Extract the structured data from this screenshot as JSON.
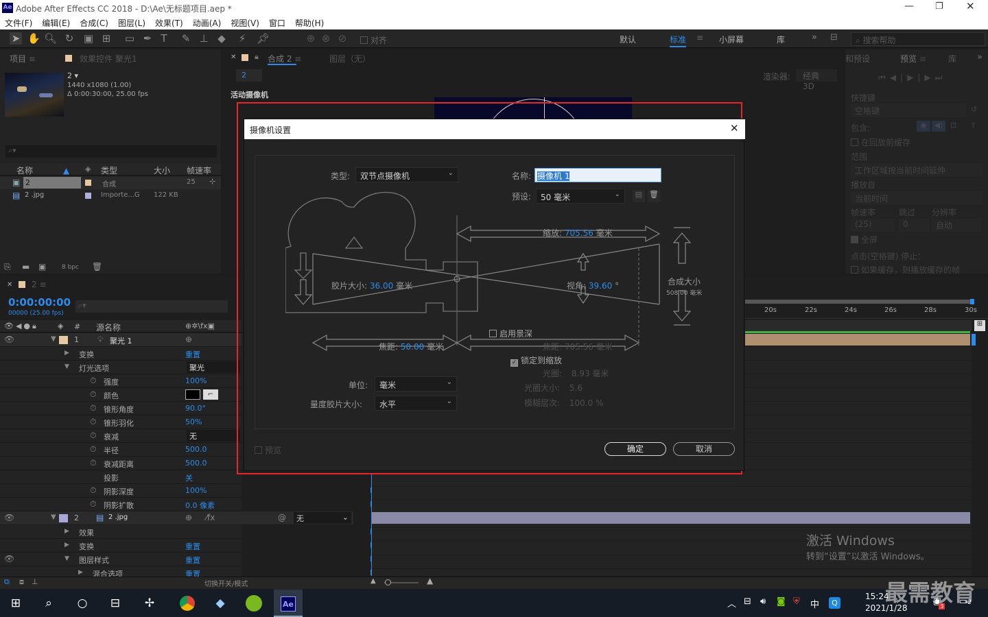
{
  "app": {
    "title": "Adobe After Effects CC 2018 - D:\\Ae\\无标题项目.aep *",
    "icon_label": "Ae"
  },
  "menu": [
    "文件(F)",
    "编辑(E)",
    "合成(C)",
    "图层(L)",
    "效果(T)",
    "动画(A)",
    "视图(V)",
    "窗口",
    "帮助(H)"
  ],
  "toolbar": {
    "snap_label": "对齐",
    "workspaces": [
      "默认",
      "标准",
      "小屏幕",
      "库"
    ],
    "active_workspace": "标准",
    "search_placeholder": "搜索帮助"
  },
  "project_panel": {
    "tab_project": "项目",
    "tab_effects": "效果控件 聚光1",
    "comp_name": "2",
    "comp_size": "1440 x1080 (1.00)",
    "comp_duration": "Δ 0:00:30:00, 25.00 fps",
    "columns": [
      "名称",
      "类型",
      "大小",
      "帧速率"
    ],
    "rows": [
      {
        "name": "2",
        "type": "合成",
        "size": "",
        "fps": "25"
      },
      {
        "name": "2 .jpg",
        "type": "Importe...G",
        "size": "122 KB",
        "fps": ""
      }
    ],
    "bpc": "8 bpc"
  },
  "comp_panel": {
    "tab_comp": "合成 2",
    "tab_layer": "图层（无）",
    "sub_tab": "2",
    "renderer_label": "渲染器:",
    "renderer_value": "经典 3D",
    "active_camera": "活动摄像机"
  },
  "right_panel": {
    "tab_info": "和预设",
    "tab_preview": "预览",
    "tab_lib": "库",
    "shortcut_label": "快捷键",
    "shortcut_value": "空格键",
    "include_label": "包含:",
    "cache_label": "在回放前缓存",
    "range_label": "范围",
    "range_value": "工作区域按当前时间延伸",
    "play_from_label": "播放自",
    "play_from_value": "当前时间",
    "fps_label": "帧速率",
    "skip_label": "跳过",
    "res_label": "分辨率",
    "fps_value": "(25)",
    "skip_value": "0",
    "res_value": "自动",
    "fullscreen_label": "全屏",
    "stop_label": "点击(空格键) 停止：",
    "stop_cache_label": "如果缓存，则播放缓存的帧"
  },
  "timeline": {
    "tab": "2",
    "timecode": "0:00:00:00",
    "timecode_sub": "00000 (25.00 fps)",
    "col_source": "源名称",
    "ruler": [
      "20s",
      "22s",
      "24s",
      "26s",
      "28s",
      "30s"
    ],
    "layer1": {
      "index": "1",
      "name": "聚光 1"
    },
    "props": [
      {
        "name": "变换",
        "value": "重置",
        "level": 1
      },
      {
        "name": "灯光选项",
        "value": "聚光",
        "level": 1
      },
      {
        "name": "强度",
        "value": "100%",
        "level": 2
      },
      {
        "name": "颜色",
        "value": "",
        "level": 2
      },
      {
        "name": "锥形角度",
        "value": "90.0°",
        "level": 2
      },
      {
        "name": "锥形羽化",
        "value": "50%",
        "level": 2
      },
      {
        "name": "衰减",
        "value": "无",
        "level": 2
      },
      {
        "name": "半径",
        "value": "500.0",
        "level": 2
      },
      {
        "name": "衰减距离",
        "value": "500.0",
        "level": 2
      },
      {
        "name": "投影",
        "value": "关",
        "level": 2
      },
      {
        "name": "阴影深度",
        "value": "100%",
        "level": 2
      },
      {
        "name": "阴影扩散",
        "value": "0.0 像素",
        "level": 2
      }
    ],
    "layer2": {
      "index": "2",
      "name": "2 .jpg",
      "parent": "无"
    },
    "props2": [
      {
        "name": "效果",
        "value": ""
      },
      {
        "name": "变换",
        "value": "重置"
      },
      {
        "name": "图层样式",
        "value": "重置"
      },
      {
        "name": "混合选项",
        "value": "重置"
      }
    ],
    "footer_toggle": "切换开关/模式"
  },
  "dialog": {
    "title": "摄像机设置",
    "type_label": "类型:",
    "type_value": "双节点摄像机",
    "name_label": "名称:",
    "name_value": "摄像机 1",
    "preset_label": "预设:",
    "preset_value": "50 毫米",
    "zoom_label": "缩放:",
    "zoom_value": "705.56",
    "zoom_unit": "毫米",
    "film_label": "胶片大小:",
    "film_value": "36.00",
    "film_unit": "毫米",
    "angle_label": "视角:",
    "angle_value": "39.60",
    "angle_unit": "°",
    "comp_size_label": "合成大小",
    "comp_size_value": "508.00 毫米",
    "dof_label": "启用景深",
    "focal_label": "焦距:",
    "focal_value": "50.00",
    "focal_unit": "毫米",
    "focus_dist_label": "焦距:",
    "focus_dist_value": "705.56 毫米",
    "lock_label": "锁定到缩放",
    "aperture_label": "光圈:",
    "aperture_value": "8.93 毫米",
    "fstop_label": "光圈大小:",
    "fstop_value": "5.6",
    "blur_label": "模糊层次:",
    "blur_value": "100.0 %",
    "units_label": "单位:",
    "units_value": "毫米",
    "measure_label": "量度胶片大小:",
    "measure_value": "水平",
    "preview_label": "预览",
    "ok_label": "确定",
    "cancel_label": "取消"
  },
  "watermark": {
    "line1": "激活 Windows",
    "line2": "转到“设置”以激活 Windows。",
    "brand": "最需教育"
  },
  "taskbar": {
    "time": "15:24",
    "date": "2021/1/28",
    "lang": "中",
    "notif_count": "2",
    "badge": "3"
  }
}
